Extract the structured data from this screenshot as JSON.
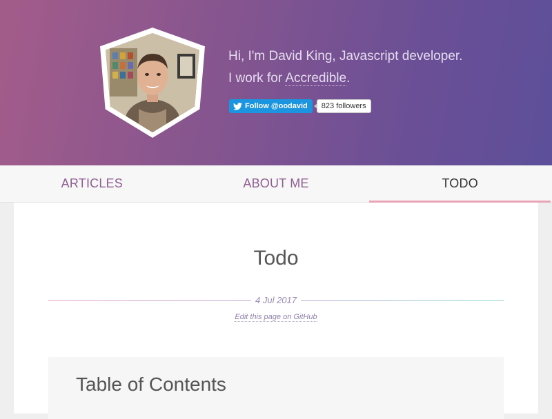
{
  "header": {
    "bio_line1": "Hi, I'm David King, Javascript developer.",
    "bio_line2_prefix": "I work for ",
    "employer_link": "Accredible",
    "bio_line2_suffix": ".",
    "twitter_follow_label": "Follow @oodavid",
    "followers_count": "823 followers",
    "avatar_icon": "portrait-photo",
    "twitter_icon": "twitter-bird-icon"
  },
  "nav": {
    "items": [
      {
        "label": "ARTICLES",
        "active": false
      },
      {
        "label": "ABOUT ME",
        "active": false
      },
      {
        "label": "TODO",
        "active": true
      }
    ]
  },
  "page": {
    "title": "Todo",
    "date": "4 Jul 2017",
    "edit_link": "Edit this page on GitHub",
    "toc_title": "Table of Contents"
  },
  "colors": {
    "header_gradient_start": "#a35c8a",
    "header_gradient_end": "#5d4f9a",
    "nav_link": "#8e5e90",
    "active_underline": "#e9a4b5",
    "twitter_blue": "#1b95e0"
  }
}
